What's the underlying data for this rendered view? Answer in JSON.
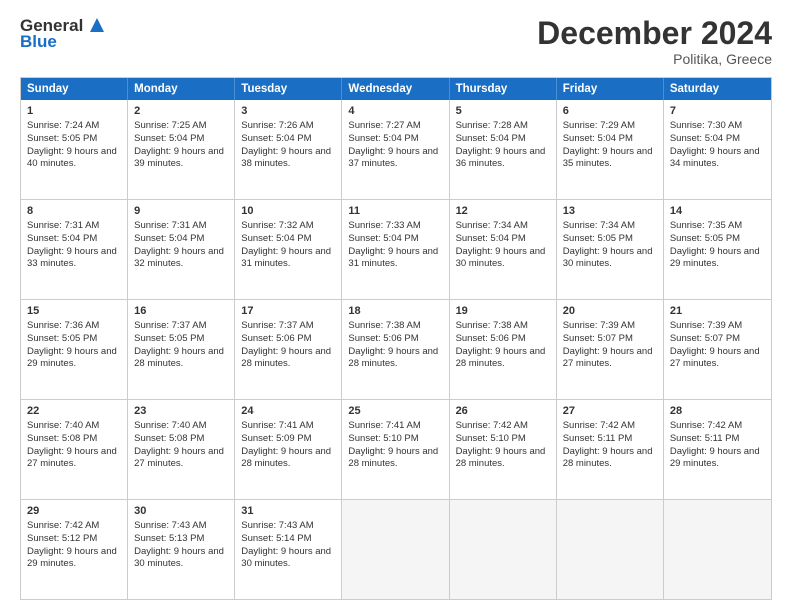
{
  "header": {
    "logo_general": "General",
    "logo_blue": "Blue",
    "month_title": "December 2024",
    "location": "Politika, Greece"
  },
  "days_of_week": [
    "Sunday",
    "Monday",
    "Tuesday",
    "Wednesday",
    "Thursday",
    "Friday",
    "Saturday"
  ],
  "weeks": [
    [
      {
        "day": 1,
        "sunrise": "Sunrise: 7:24 AM",
        "sunset": "Sunset: 5:05 PM",
        "daylight": "Daylight: 9 hours and 40 minutes."
      },
      {
        "day": 2,
        "sunrise": "Sunrise: 7:25 AM",
        "sunset": "Sunset: 5:04 PM",
        "daylight": "Daylight: 9 hours and 39 minutes."
      },
      {
        "day": 3,
        "sunrise": "Sunrise: 7:26 AM",
        "sunset": "Sunset: 5:04 PM",
        "daylight": "Daylight: 9 hours and 38 minutes."
      },
      {
        "day": 4,
        "sunrise": "Sunrise: 7:27 AM",
        "sunset": "Sunset: 5:04 PM",
        "daylight": "Daylight: 9 hours and 37 minutes."
      },
      {
        "day": 5,
        "sunrise": "Sunrise: 7:28 AM",
        "sunset": "Sunset: 5:04 PM",
        "daylight": "Daylight: 9 hours and 36 minutes."
      },
      {
        "day": 6,
        "sunrise": "Sunrise: 7:29 AM",
        "sunset": "Sunset: 5:04 PM",
        "daylight": "Daylight: 9 hours and 35 minutes."
      },
      {
        "day": 7,
        "sunrise": "Sunrise: 7:30 AM",
        "sunset": "Sunset: 5:04 PM",
        "daylight": "Daylight: 9 hours and 34 minutes."
      }
    ],
    [
      {
        "day": 8,
        "sunrise": "Sunrise: 7:31 AM",
        "sunset": "Sunset: 5:04 PM",
        "daylight": "Daylight: 9 hours and 33 minutes."
      },
      {
        "day": 9,
        "sunrise": "Sunrise: 7:31 AM",
        "sunset": "Sunset: 5:04 PM",
        "daylight": "Daylight: 9 hours and 32 minutes."
      },
      {
        "day": 10,
        "sunrise": "Sunrise: 7:32 AM",
        "sunset": "Sunset: 5:04 PM",
        "daylight": "Daylight: 9 hours and 31 minutes."
      },
      {
        "day": 11,
        "sunrise": "Sunrise: 7:33 AM",
        "sunset": "Sunset: 5:04 PM",
        "daylight": "Daylight: 9 hours and 31 minutes."
      },
      {
        "day": 12,
        "sunrise": "Sunrise: 7:34 AM",
        "sunset": "Sunset: 5:04 PM",
        "daylight": "Daylight: 9 hours and 30 minutes."
      },
      {
        "day": 13,
        "sunrise": "Sunrise: 7:34 AM",
        "sunset": "Sunset: 5:05 PM",
        "daylight": "Daylight: 9 hours and 30 minutes."
      },
      {
        "day": 14,
        "sunrise": "Sunrise: 7:35 AM",
        "sunset": "Sunset: 5:05 PM",
        "daylight": "Daylight: 9 hours and 29 minutes."
      }
    ],
    [
      {
        "day": 15,
        "sunrise": "Sunrise: 7:36 AM",
        "sunset": "Sunset: 5:05 PM",
        "daylight": "Daylight: 9 hours and 29 minutes."
      },
      {
        "day": 16,
        "sunrise": "Sunrise: 7:37 AM",
        "sunset": "Sunset: 5:05 PM",
        "daylight": "Daylight: 9 hours and 28 minutes."
      },
      {
        "day": 17,
        "sunrise": "Sunrise: 7:37 AM",
        "sunset": "Sunset: 5:06 PM",
        "daylight": "Daylight: 9 hours and 28 minutes."
      },
      {
        "day": 18,
        "sunrise": "Sunrise: 7:38 AM",
        "sunset": "Sunset: 5:06 PM",
        "daylight": "Daylight: 9 hours and 28 minutes."
      },
      {
        "day": 19,
        "sunrise": "Sunrise: 7:38 AM",
        "sunset": "Sunset: 5:06 PM",
        "daylight": "Daylight: 9 hours and 28 minutes."
      },
      {
        "day": 20,
        "sunrise": "Sunrise: 7:39 AM",
        "sunset": "Sunset: 5:07 PM",
        "daylight": "Daylight: 9 hours and 27 minutes."
      },
      {
        "day": 21,
        "sunrise": "Sunrise: 7:39 AM",
        "sunset": "Sunset: 5:07 PM",
        "daylight": "Daylight: 9 hours and 27 minutes."
      }
    ],
    [
      {
        "day": 22,
        "sunrise": "Sunrise: 7:40 AM",
        "sunset": "Sunset: 5:08 PM",
        "daylight": "Daylight: 9 hours and 27 minutes."
      },
      {
        "day": 23,
        "sunrise": "Sunrise: 7:40 AM",
        "sunset": "Sunset: 5:08 PM",
        "daylight": "Daylight: 9 hours and 27 minutes."
      },
      {
        "day": 24,
        "sunrise": "Sunrise: 7:41 AM",
        "sunset": "Sunset: 5:09 PM",
        "daylight": "Daylight: 9 hours and 28 minutes."
      },
      {
        "day": 25,
        "sunrise": "Sunrise: 7:41 AM",
        "sunset": "Sunset: 5:10 PM",
        "daylight": "Daylight: 9 hours and 28 minutes."
      },
      {
        "day": 26,
        "sunrise": "Sunrise: 7:42 AM",
        "sunset": "Sunset: 5:10 PM",
        "daylight": "Daylight: 9 hours and 28 minutes."
      },
      {
        "day": 27,
        "sunrise": "Sunrise: 7:42 AM",
        "sunset": "Sunset: 5:11 PM",
        "daylight": "Daylight: 9 hours and 28 minutes."
      },
      {
        "day": 28,
        "sunrise": "Sunrise: 7:42 AM",
        "sunset": "Sunset: 5:11 PM",
        "daylight": "Daylight: 9 hours and 29 minutes."
      }
    ],
    [
      {
        "day": 29,
        "sunrise": "Sunrise: 7:42 AM",
        "sunset": "Sunset: 5:12 PM",
        "daylight": "Daylight: 9 hours and 29 minutes."
      },
      {
        "day": 30,
        "sunrise": "Sunrise: 7:43 AM",
        "sunset": "Sunset: 5:13 PM",
        "daylight": "Daylight: 9 hours and 30 minutes."
      },
      {
        "day": 31,
        "sunrise": "Sunrise: 7:43 AM",
        "sunset": "Sunset: 5:14 PM",
        "daylight": "Daylight: 9 hours and 30 minutes."
      },
      null,
      null,
      null,
      null
    ]
  ]
}
